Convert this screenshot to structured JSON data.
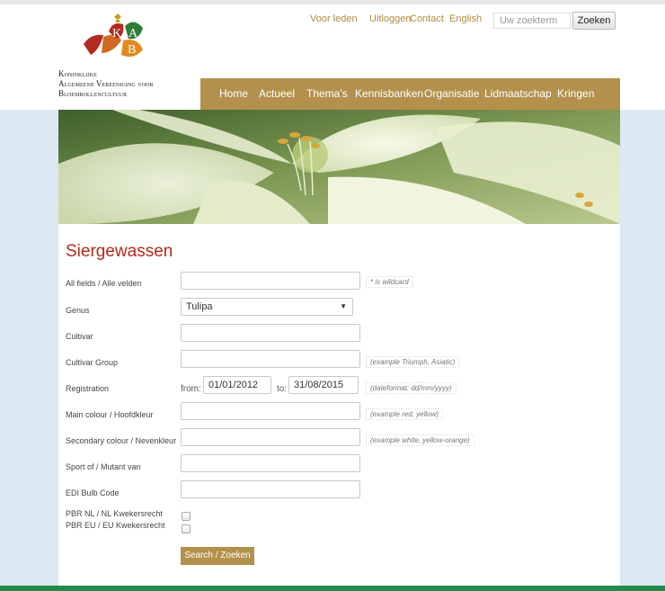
{
  "logo": {
    "lines": [
      "Koninklijke",
      "Algemeene Vereeniging voor",
      "Bloembollencultuur"
    ],
    "letters": [
      "K",
      "A",
      "B"
    ]
  },
  "toplinks": [
    "Voor leden",
    "Uitloggen",
    "Contact",
    "English"
  ],
  "search": {
    "placeholder": "Uw zoekterm",
    "button": "Zoeken"
  },
  "nav": [
    "Home",
    "Actueel",
    "Thema's",
    "Kennisbanken",
    "Organisatie",
    "Lidmaatschap",
    "Kringen"
  ],
  "form": {
    "title": "Siergewassen",
    "fields": {
      "all_label": "All fields / Alle velden",
      "all_hint": "* is wildcard",
      "genus_label": "Genus",
      "genus_value": "Tulipa",
      "cultivar_label": "Cultivar",
      "group_label": "Cultivar Group",
      "group_hint": "(example Triumph, Asiatic)",
      "registration_label": "Registration",
      "from_label": "from:",
      "from_value": "01/01/2012",
      "to_label": "to:",
      "to_value": "31/08/2015",
      "date_hint": "(dateformat: dd/mm/yyyy)",
      "main_colour_label": "Main colour / Hoofdkleur",
      "main_colour_hint": "(example red, yellow)",
      "secondary_colour_label": "Secondary colour / Nevenkleur",
      "secondary_colour_hint": "(example white, yellow-orange)",
      "sport_label": "Sport of / Mutant van",
      "edi_label": "EDI Bulb Code",
      "pbr_nl_label": "PBR NL / NL Kwekersrecht",
      "pbr_eu_label": "PBR EU / EU Kwekersrecht"
    },
    "submit": "Search / Zoeken"
  },
  "colors": {
    "accent": "#b3914d",
    "title": "#b12a1c",
    "background": "#dce8f2",
    "footer": "#1e8a4c"
  }
}
